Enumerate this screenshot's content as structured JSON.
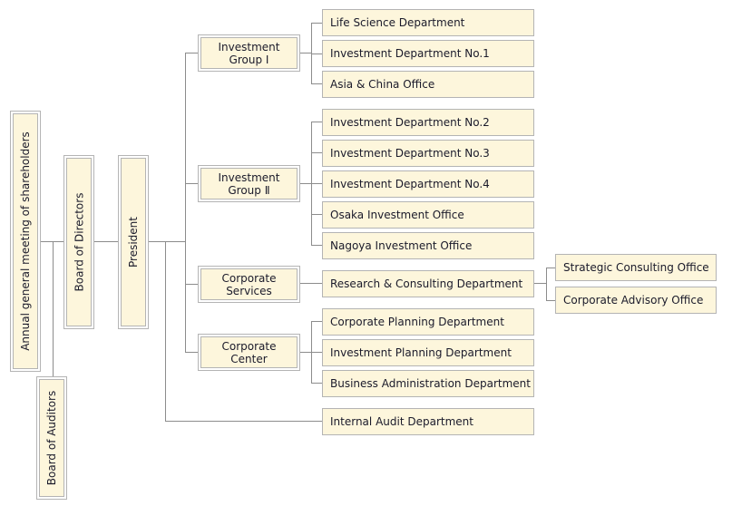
{
  "colors": {
    "box_fill": "#fdf6dc",
    "border": "#b4b4b4",
    "line": "#8c8c8c"
  },
  "top": {
    "shareholders": "Annual general meeting of shareholders",
    "board_directors": "Board of Directors",
    "president": "President",
    "board_auditors": "Board of Auditors"
  },
  "groups": [
    {
      "line1": "Investment",
      "line2": "Group Ⅰ"
    },
    {
      "line1": "Investment",
      "line2": "Group Ⅱ"
    },
    {
      "line1": "Corporate",
      "line2": "Services"
    },
    {
      "line1": "Corporate",
      "line2": "Center"
    }
  ],
  "departments": [
    "Life Science Department",
    "Investment Department No.1",
    "Asia & China Office",
    "Investment Department No.2",
    "Investment Department No.3",
    "Investment Department No.4",
    "Osaka Investment Office",
    "Nagoya Investment Office",
    "Research & Consulting Department",
    "Corporate Planning Department",
    "Investment Planning Department",
    "Business Administration Department",
    "Internal Audit Department"
  ],
  "offices": [
    "Strategic Consulting Office",
    "Corporate Advisory Office"
  ]
}
